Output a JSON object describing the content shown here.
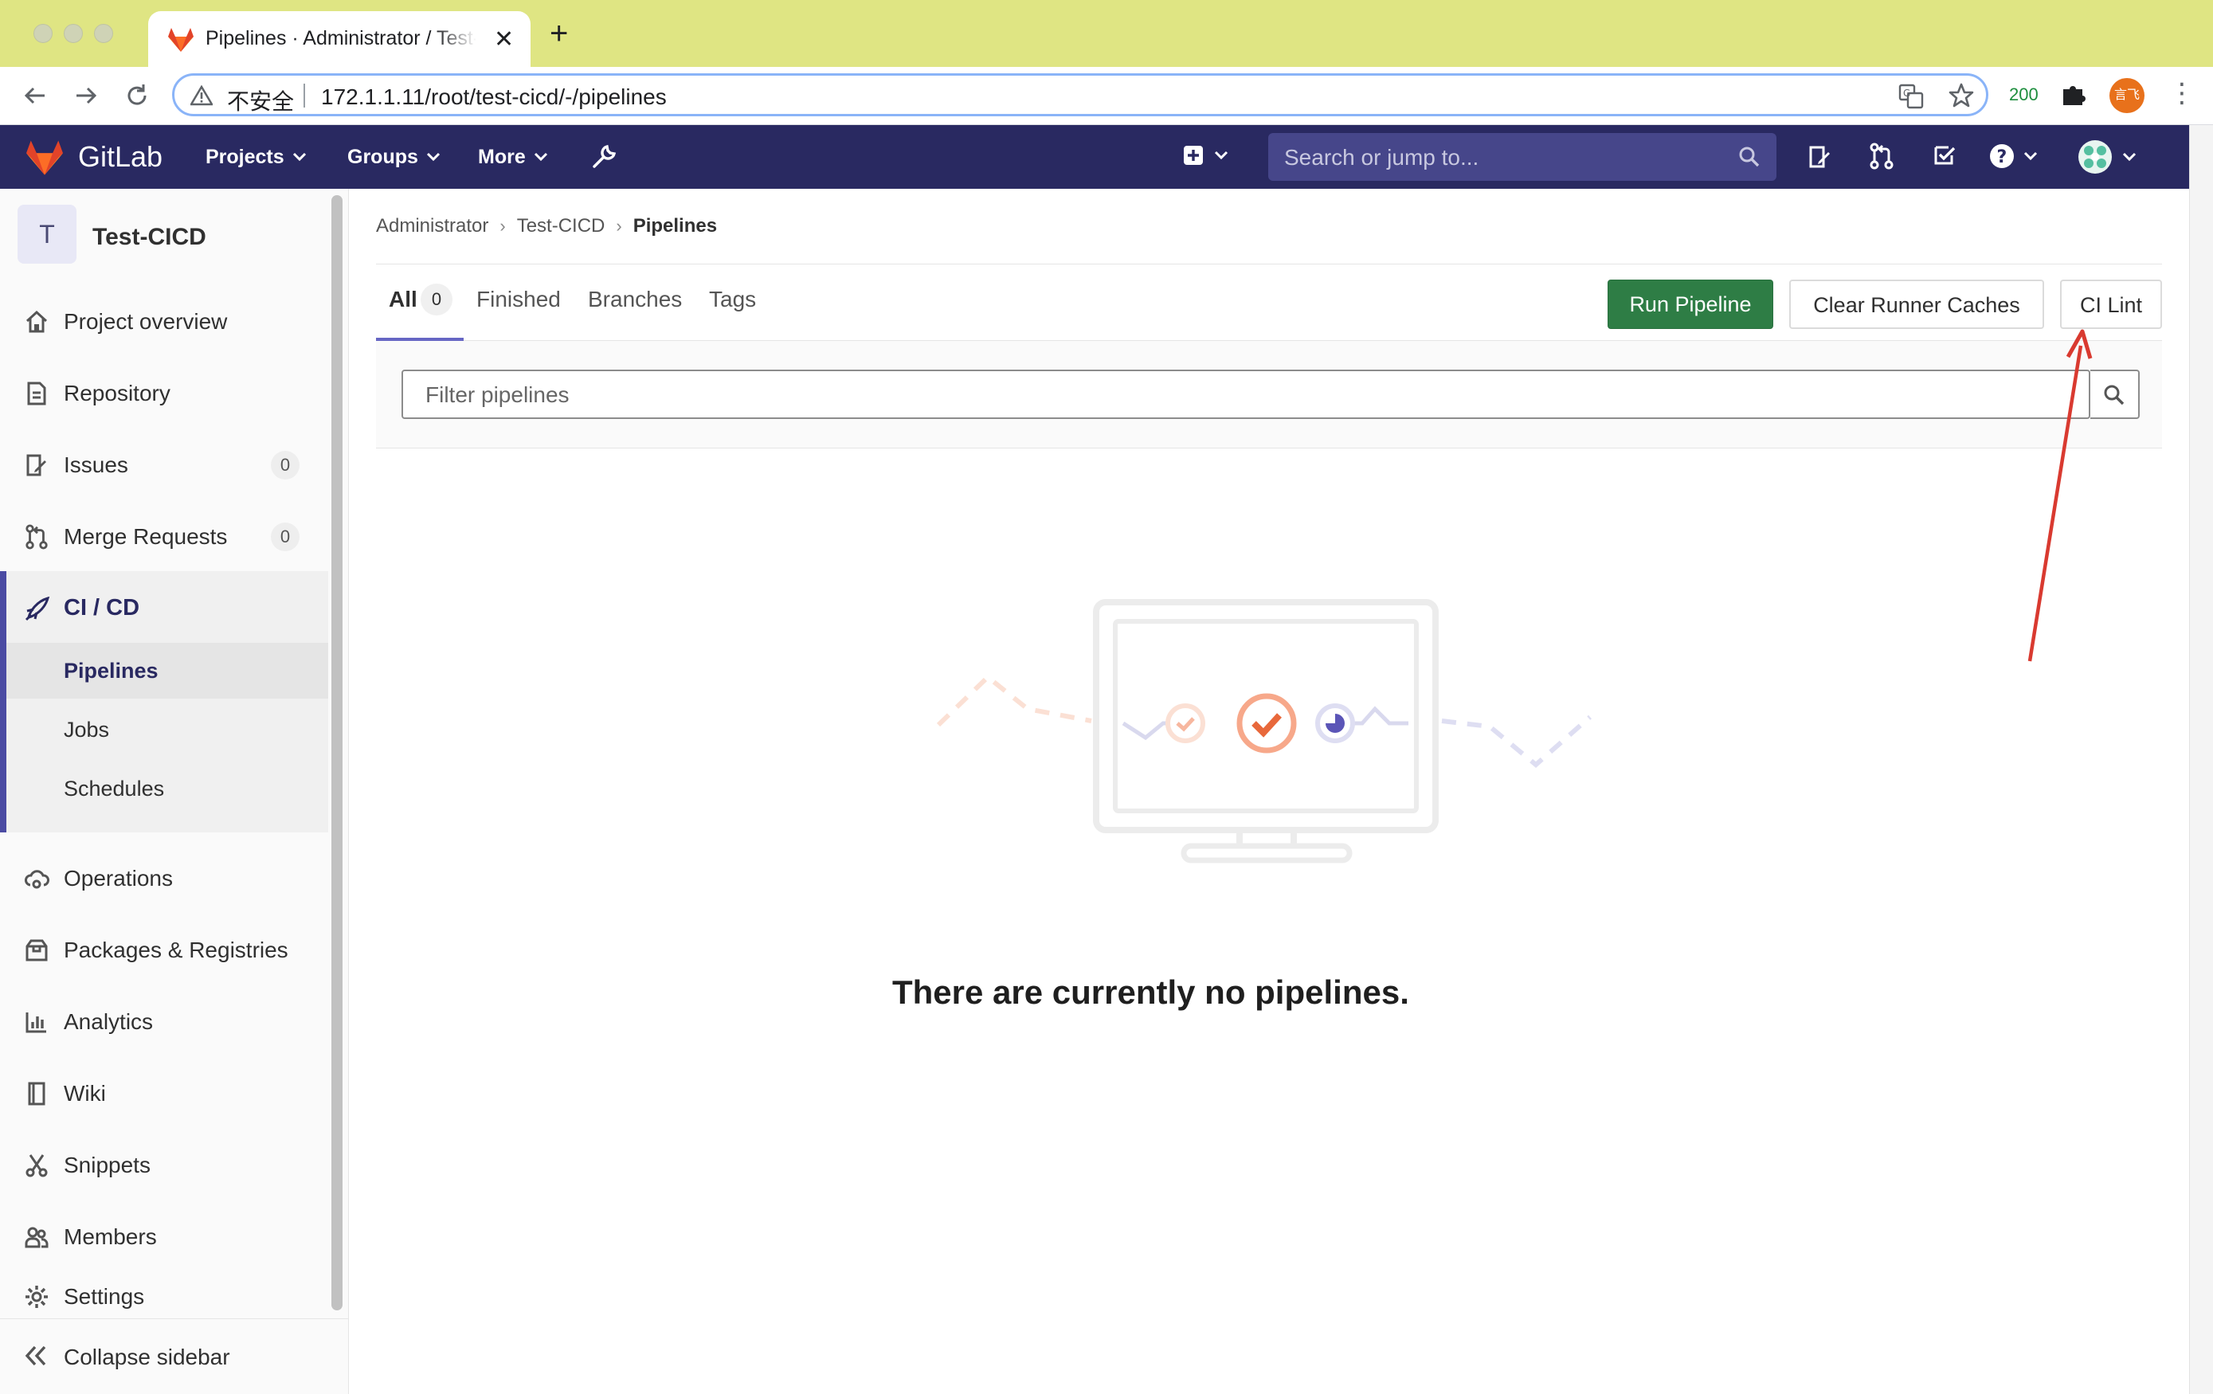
{
  "browser": {
    "tab_title": "Pipelines · Administrator / Test-CICD",
    "security_label": "不安全",
    "url": "172.1.1.11/root/test-cicd/-/pipelines",
    "extension_count": "200",
    "profile_initials": "言飞"
  },
  "gitlab_nav": {
    "brand": "GitLab",
    "projects_label": "Projects",
    "groups_label": "Groups",
    "more_label": "More",
    "search_placeholder": "Search or jump to..."
  },
  "sidebar": {
    "project_initial": "T",
    "project_name": "Test-CICD",
    "items": [
      {
        "label": "Project overview",
        "icon": "home-icon"
      },
      {
        "label": "Repository",
        "icon": "document-icon"
      },
      {
        "label": "Issues",
        "icon": "issues-icon",
        "badge": "0"
      },
      {
        "label": "Merge Requests",
        "icon": "merge-request-icon",
        "badge": "0"
      },
      {
        "label": "CI / CD",
        "icon": "rocket-icon"
      },
      {
        "label": "Operations",
        "icon": "cloud-gear-icon"
      },
      {
        "label": "Packages & Registries",
        "icon": "package-icon"
      },
      {
        "label": "Analytics",
        "icon": "chart-icon"
      },
      {
        "label": "Wiki",
        "icon": "book-icon"
      },
      {
        "label": "Snippets",
        "icon": "scissors-icon"
      },
      {
        "label": "Members",
        "icon": "users-icon"
      },
      {
        "label": "Settings",
        "icon": "gear-icon"
      }
    ],
    "cicd_subitems": [
      "Pipelines",
      "Jobs",
      "Schedules"
    ],
    "collapse_label": "Collapse sidebar"
  },
  "breadcrumb": [
    "Administrator",
    "Test-CICD",
    "Pipelines"
  ],
  "tabs": {
    "all": "All",
    "all_count": "0",
    "finished": "Finished",
    "branches": "Branches",
    "tags": "Tags"
  },
  "actions": {
    "run_pipeline": "Run Pipeline",
    "clear_runner_caches": "Clear Runner Caches",
    "ci_lint": "CI Lint"
  },
  "filter": {
    "placeholder": "Filter pipelines"
  },
  "empty_state": {
    "message": "There are currently no pipelines."
  },
  "colors": {
    "nav_bg": "#292961",
    "run_button": "#2e7d45",
    "annotation_arrow": "#d93a30",
    "browser_frame": "#dfe583"
  }
}
